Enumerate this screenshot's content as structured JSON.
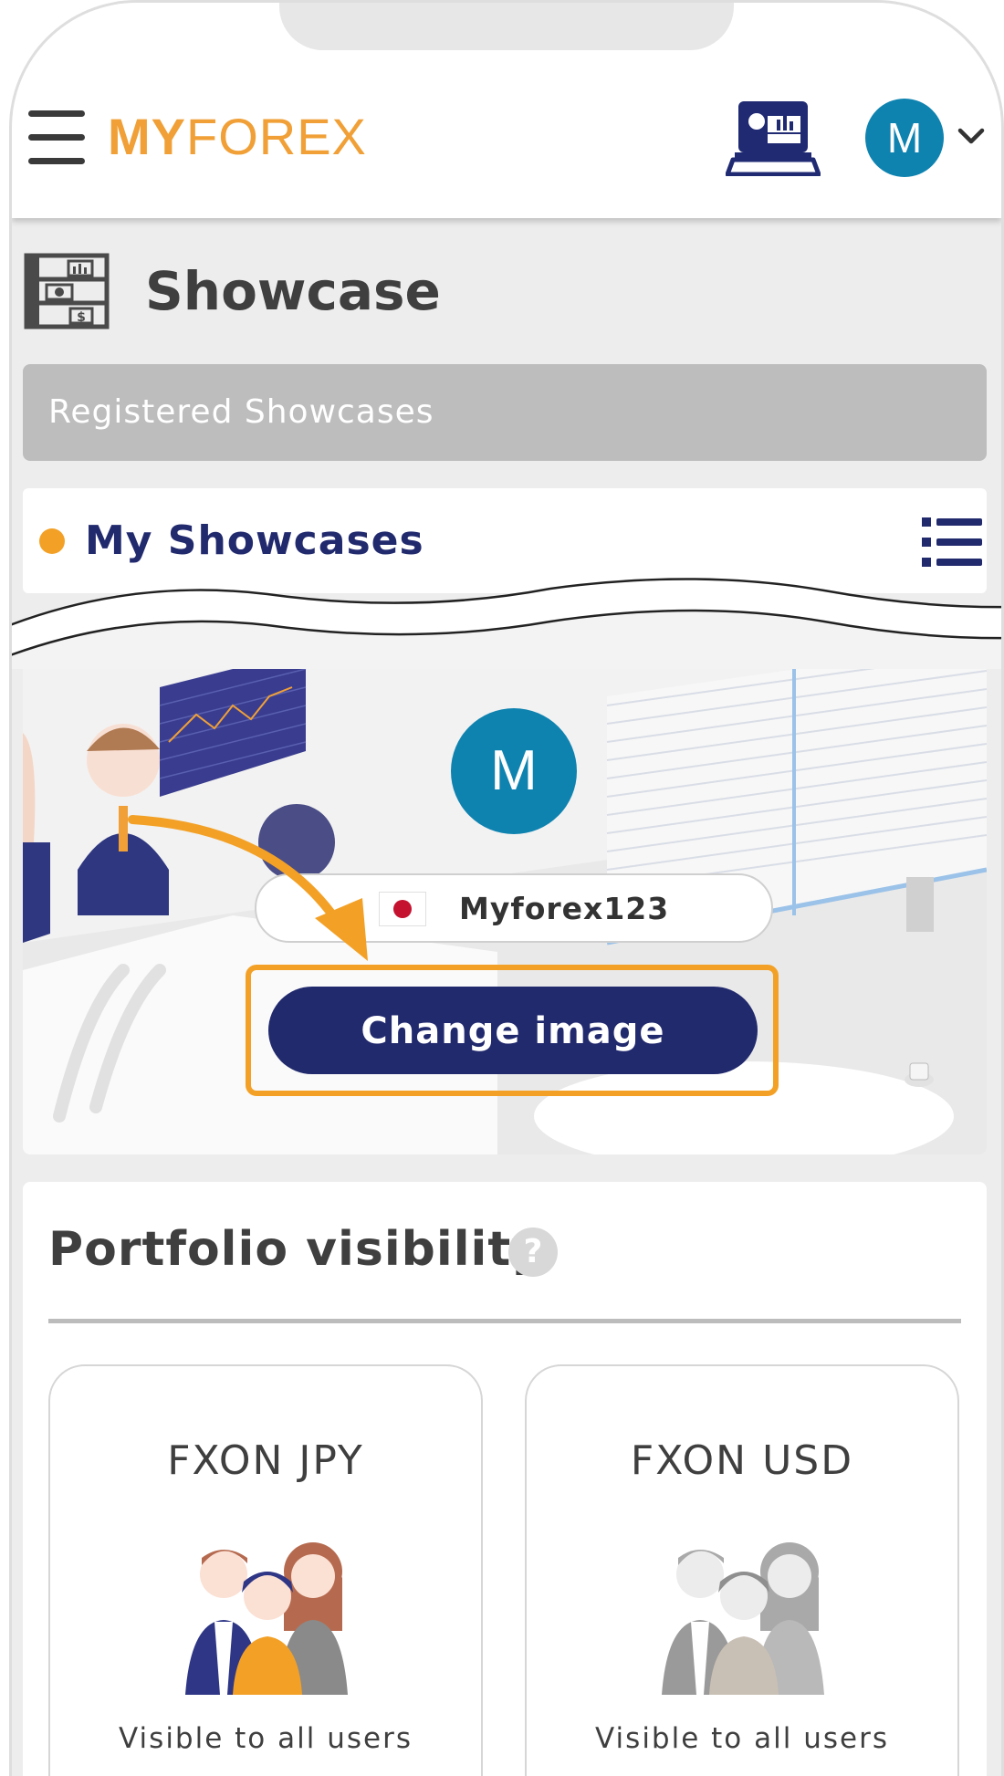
{
  "header": {
    "logo_bold": "MY",
    "logo_rest": "FOREX",
    "avatar_initial": "M"
  },
  "page": {
    "title": "Showcase",
    "registered_label": "Registered Showcases",
    "my_showcases_label": "My Showcases"
  },
  "profile": {
    "avatar_initial": "M",
    "username": "Myforex123",
    "change_image_label": "Change image"
  },
  "portfolio": {
    "title": "Portfolio visibility",
    "help_symbol": "?",
    "cards": [
      {
        "title": "FXON JPY",
        "visibility": "Visible to all users"
      },
      {
        "title": "FXON USD",
        "visibility": "Visible to all users"
      }
    ]
  },
  "colors": {
    "brand_orange": "#f0a037",
    "navy": "#222a6e",
    "avatar_blue": "#0f83b0",
    "highlight": "#f3a126"
  }
}
